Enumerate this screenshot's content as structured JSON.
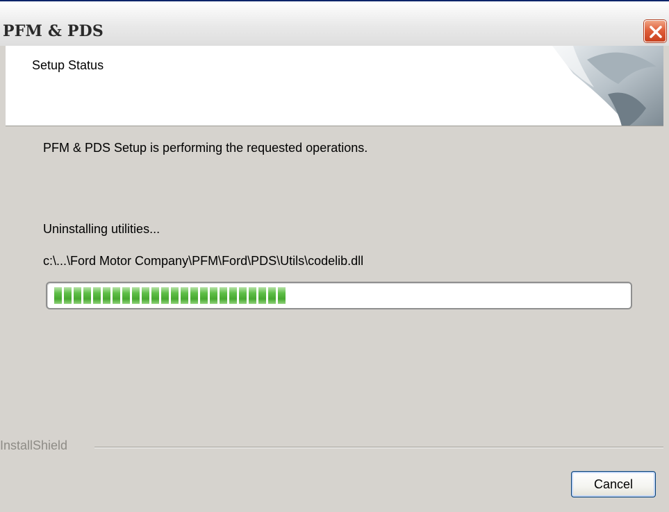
{
  "window": {
    "title": "PFM & PDS"
  },
  "header": {
    "title": "Setup Status"
  },
  "body": {
    "status_message": "PFM & PDS Setup is performing the requested operations.",
    "operation": "Uninstalling utilities...",
    "current_file": "c:\\...\\Ford Motor Company\\PFM\\Ford\\PDS\\Utils\\codelib.dll"
  },
  "progress": {
    "fraction": 0.42,
    "color": "#47a830"
  },
  "footer": {
    "brand": "InstallShield",
    "cancel_label": "Cancel"
  },
  "icons": {
    "close": "close-icon",
    "header_art": "setup-art-icon"
  },
  "colors": {
    "close_button": "#e0603b",
    "dialog_face": "#d6d3ce",
    "brand_text": "#8e8c86"
  }
}
